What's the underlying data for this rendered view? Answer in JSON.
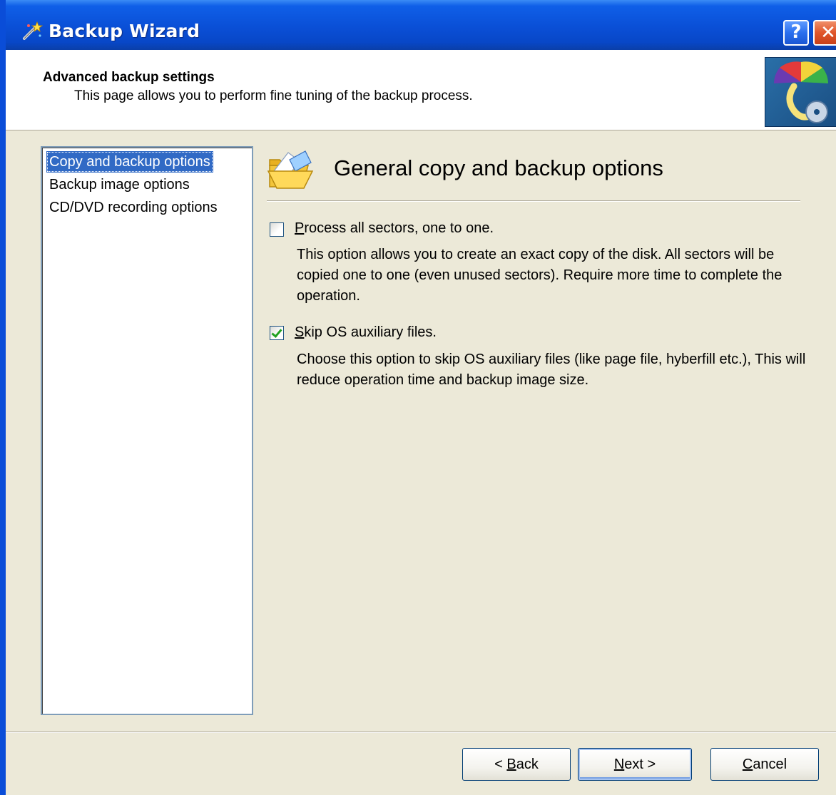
{
  "window": {
    "title": "Backup Wizard",
    "help_label": "?",
    "close_label": "✕"
  },
  "header": {
    "title": "Advanced backup settings",
    "subtitle": "This page allows you to perform fine tuning of the backup process."
  },
  "sidebar": {
    "items": [
      {
        "label": "Copy and backup options",
        "selected": true
      },
      {
        "label": "Backup image options",
        "selected": false
      },
      {
        "label": "CD/DVD recording options",
        "selected": false
      }
    ]
  },
  "panel": {
    "title": "General copy and backup options",
    "options": [
      {
        "mnemonic": "P",
        "label_rest": "rocess all sectors, one to one.",
        "checked": false,
        "description": "This option allows you to create an exact copy of the disk. All sectors will be copied one to one (even unused sectors). Require more time to complete the operation."
      },
      {
        "mnemonic": "S",
        "label_rest": "kip OS auxiliary files.",
        "checked": true,
        "description": "Choose this option to skip OS auxiliary files (like page file, hyberfill etc.), This will reduce operation time and backup image size."
      }
    ]
  },
  "buttons": {
    "back_prefix": "< ",
    "back_mnemonic": "B",
    "back_rest": "ack",
    "next_mnemonic": "N",
    "next_rest": "ext >",
    "cancel_mnemonic": "C",
    "cancel_rest": "ancel"
  },
  "colors": {
    "titlebar": "#0a4fd6",
    "selection": "#316ac5",
    "dialog_bg": "#ece9d8"
  }
}
